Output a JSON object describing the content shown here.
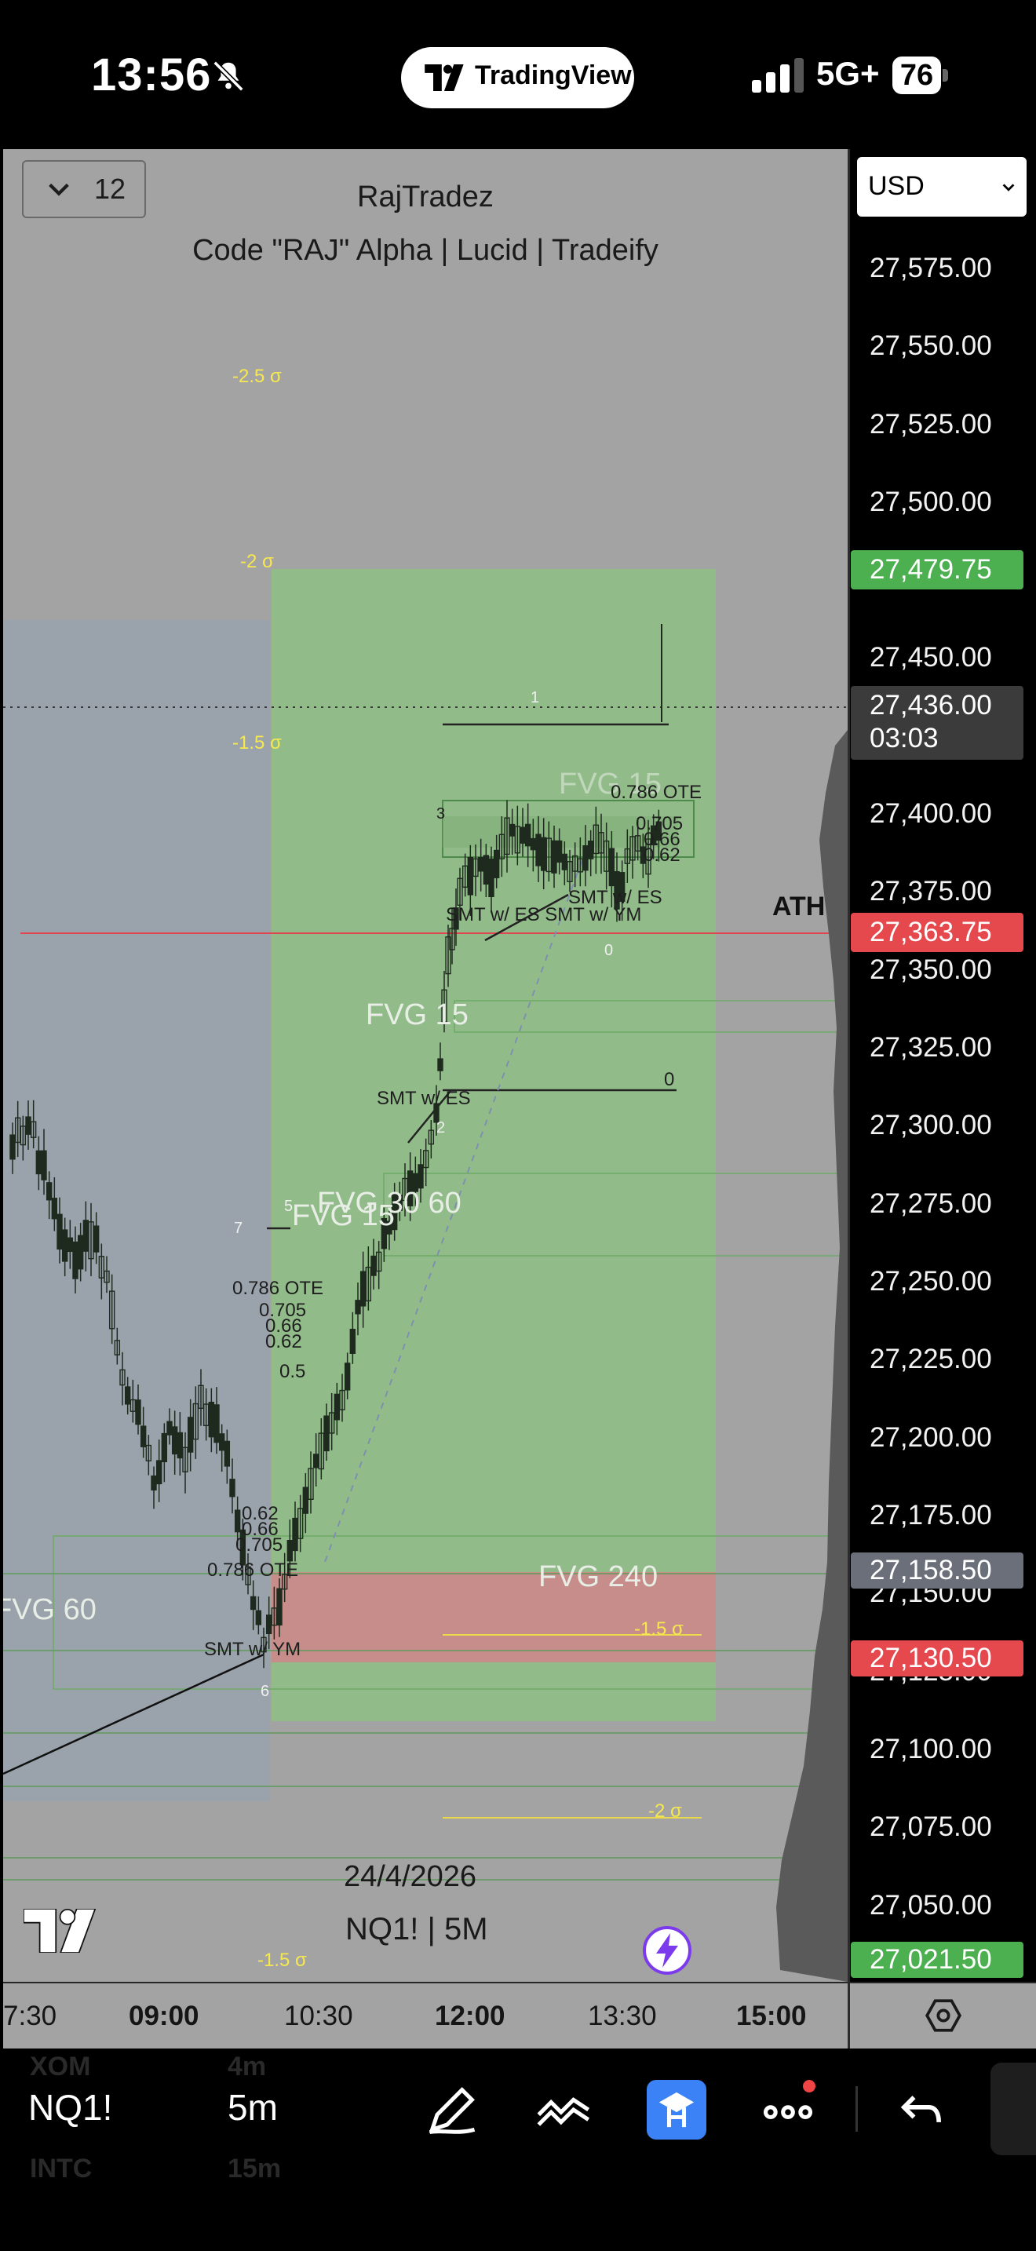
{
  "status_bar": {
    "time": "13:56",
    "app_pill": "TradingView",
    "network": "5G+",
    "battery": "76"
  },
  "chart": {
    "interval_button": "12",
    "title": "RajTradez",
    "subtitle": "Code \"RAJ\" Alpha | Lucid | Tradeify",
    "date": "24/4/2026",
    "symbol_timeframe": "NQ1! | 5M",
    "ath_label": "ATH",
    "annotations": {
      "sigma_25": "-2.5 σ",
      "sigma_2_top": "-2 σ",
      "sigma_15_top": "-1.5 σ",
      "sigma_15_right": "-1.5 σ",
      "sigma_2_right": "-2 σ",
      "sigma_15_bottom": "-1.5 σ",
      "ote_top": "0.786 OTE",
      "fib_705_top": "0.705",
      "fib_66_top": "0.66",
      "fib_62_top": "0.62",
      "smt_es_top": "SMT w/ ES",
      "smt_ym_es": "SMT w/ ES SMT w/ YM",
      "smt_es_mid": "SMT w/ ES",
      "smt_ym_bottom": "SMT w/ YM",
      "ote_left": "0.786 OTE",
      "fib_705_left": "0.705",
      "fib_66_left": "0.66",
      "fib_62_left": "0.62",
      "fib_5_left": "0.5",
      "ote_bottom": "0.786 OTE",
      "fib_705_bottom": "0.705",
      "fib_66_bottom": "0.66",
      "fib_62_bottom": "0.62",
      "num_1": "1",
      "num_2": "2",
      "num_3": "3",
      "num_0_top": "0",
      "num_0_mid": "0",
      "num_5": "5",
      "num_6": "6",
      "num_7": "7",
      "fvg_15_top": "FVG 15",
      "fvg_15_mid": "FVG 15",
      "fvg_30_60": "FVG 30 60",
      "fvg_240": "FVG 240",
      "fvg_60_left": "FVG 60",
      "fvg_15_hidden": "FVG 15"
    }
  },
  "price_axis": {
    "currency": "USD",
    "ticks": [
      "27,575.00",
      "27,550.00",
      "27,525.00",
      "27,500.00",
      "27,450.00",
      "27,400.00",
      "27,375.00",
      "27,350.00",
      "27,325.00",
      "27,300.00",
      "27,275.00",
      "27,250.00",
      "27,225.00",
      "27,200.00",
      "27,175.00",
      "27,150.00",
      "27,125.00",
      "27,100.00",
      "27,075.00",
      "27,050.00"
    ],
    "badges": {
      "high": "27,479.75",
      "last_price": "27,436.00",
      "countdown": "03:03",
      "ath": "27,363.75",
      "level_grey": "27,158.50",
      "level_red": "27,130.50",
      "low": "27,021.50"
    }
  },
  "time_axis": {
    "ticks": [
      "7:30",
      "09:00",
      "10:30",
      "12:00",
      "13:30",
      "15:00"
    ]
  },
  "toolbar": {
    "symbol": "NQ1!",
    "interval": "5m",
    "ghost_symbol_top": "XOM",
    "ghost_interval_top": "4m",
    "ghost_symbol_bottom": "INTC",
    "ghost_interval_bottom": "15m"
  },
  "colors": {
    "chart_bg": "#a3a3a3",
    "green_zone": "#8fbf86",
    "red_zone": "#c98a8a",
    "ath_line": "#e0464f",
    "badge_green": "#4caf50",
    "badge_red": "#e5484d",
    "badge_grey": "#6b6f7a",
    "badge_dark": "#3b3b3b",
    "sigma_yellow": "#f6e84e",
    "active_tool": "#3b82f6"
  }
}
